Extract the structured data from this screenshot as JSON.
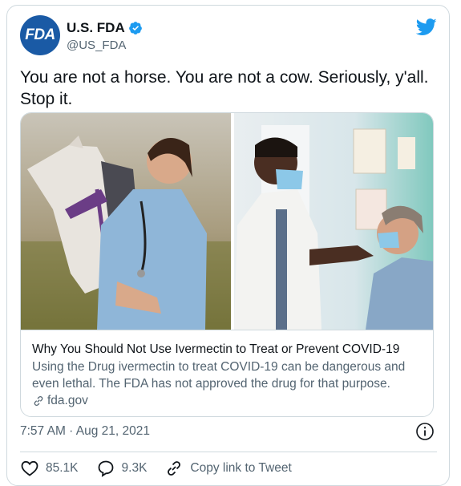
{
  "account": {
    "avatar_text": "FDA",
    "display_name": "U.S. FDA",
    "handle": "@US_FDA",
    "verified": true,
    "brand_color": "#1a5aa5"
  },
  "tweet": {
    "text": "You are not a horse. You are not a cow. Seriously, y'all. Stop it."
  },
  "card": {
    "title": "Why You Should Not Use Ivermectin to Treat or Prevent COVID-19",
    "description": "Using the Drug ivermectin to treat COVID-19 can be dangerous and even lethal. The FDA has not approved the drug for that purpose.",
    "domain": "fda.gov"
  },
  "meta": {
    "timestamp": "7:57 AM · Aug 21, 2021"
  },
  "actions": {
    "likes": "85.1K",
    "replies": "9.3K",
    "copy_link": "Copy link to Tweet"
  },
  "icons": {
    "logo": "twitter-bird-icon",
    "verified": "verified-badge-icon",
    "info": "info-icon",
    "like": "heart-icon",
    "reply": "speech-bubble-icon",
    "link": "link-icon"
  },
  "colors": {
    "twitter_blue": "#1d9bf0",
    "secondary_text": "#536471",
    "border": "#cfd9de"
  }
}
